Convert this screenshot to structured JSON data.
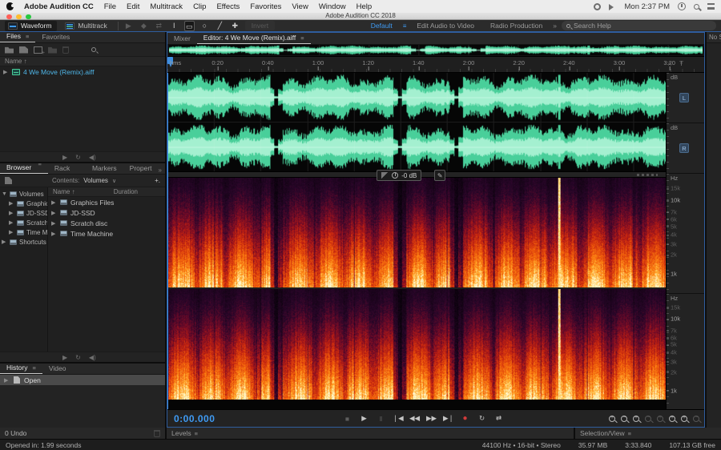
{
  "menubar": {
    "app_name": "Adobe Audition CC",
    "menus": [
      "File",
      "Edit",
      "Multitrack",
      "Clip",
      "Effects",
      "Favorites",
      "View",
      "Window",
      "Help"
    ],
    "clock": "Mon 2:37 PM"
  },
  "window": {
    "title": "Adobe Audition CC 2018"
  },
  "toolbar": {
    "waveform_label": "Waveform",
    "multitrack_label": "Multitrack",
    "invert_label": "Invert",
    "workspace_default": "Default",
    "workspace_items": [
      "Edit Audio to Video",
      "Radio Production"
    ],
    "search_placeholder": "Search Help"
  },
  "files_panel": {
    "tab_files": "Files",
    "tab_favorites": "Favorites",
    "name_header": "Name",
    "file_item": "4 We Move (Remix).aiff"
  },
  "media_browser": {
    "tab_media_browser": "Media Browser",
    "tab_effects_rack": "Effects Rack",
    "tab_markers": "Markers",
    "tab_properties": "Propert",
    "contents_label": "Contents:",
    "contents_value": "Volumes",
    "tree_root": "Volumes",
    "tree_shortcuts": "Shortcuts",
    "name_header": "Name",
    "duration_header": "Duration",
    "volumes": [
      "Graphics Files",
      "JD-SSD",
      "Scratch disc",
      "Time Machine"
    ]
  },
  "history_panel": {
    "tab_history": "History",
    "tab_video": "Video",
    "entry_open": "Open"
  },
  "editor": {
    "tab_mixer": "Mixer",
    "tab_editor": "Editor: 4 We Move (Remix).aiff",
    "ruler_unit": "hms",
    "ruler_ticks": [
      "0:20",
      "0:40",
      "1:00",
      "1:20",
      "1:40",
      "2:00",
      "2:20",
      "2:40",
      "3:00",
      "3:20"
    ],
    "db_label": "dB",
    "hz_label": "Hz",
    "hz_ticks": [
      {
        "label": "15k"
      },
      {
        "label": "10k"
      },
      {
        "label": "7k"
      },
      {
        "label": "6k"
      },
      {
        "label": "5k"
      },
      {
        "label": "4k"
      },
      {
        "label": "3k"
      },
      {
        "label": "2k"
      },
      {
        "label": "1k"
      }
    ],
    "channel_left": "L",
    "channel_right": "R",
    "hud_value": "-0 dB",
    "time_display": "0:00.000",
    "right_strip_label": "No S"
  },
  "bottom_bars": {
    "undo_status": "0 Undo",
    "levels_tab": "Levels",
    "selection_view_tab": "Selection/View"
  },
  "statusbar": {
    "opened_message": "Opened in: 1.99 seconds",
    "format": "44100 Hz • 16-bit • Stereo",
    "file_size": "35.97 MB",
    "duration": "3:33.840",
    "free_space": "107.13 GB free"
  },
  "colors": {
    "accent_blue": "#3f9bf4",
    "waveform_green": "#4fd9a0",
    "record_red": "#d23b3b",
    "focus_border": "#2f5d9e"
  }
}
